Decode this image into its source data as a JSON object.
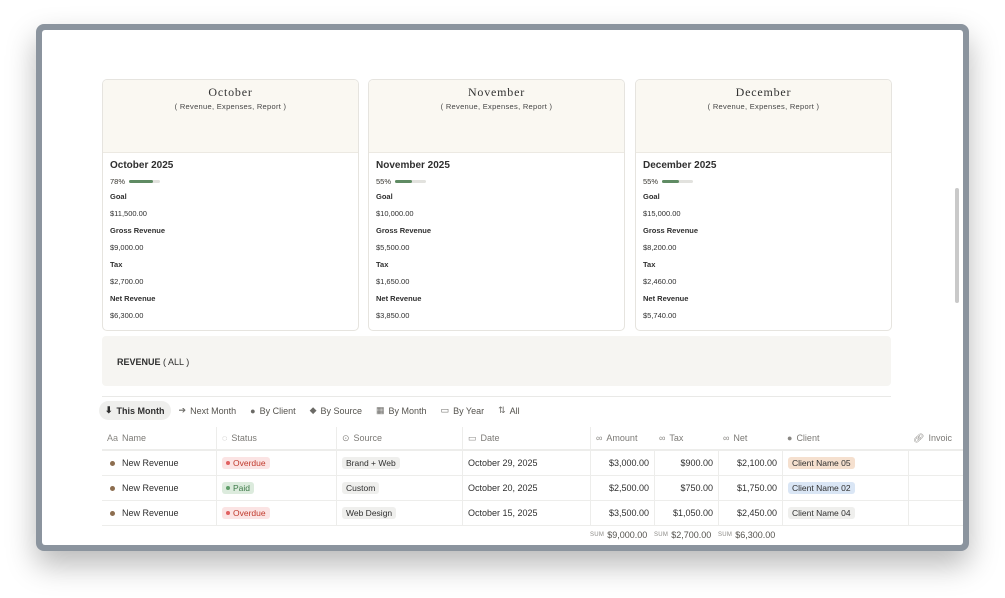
{
  "cards": [
    {
      "cover_title": "October",
      "cover_sub": "( Revenue, Expenses, Report )",
      "title": "October 2025",
      "progress_label": "78%",
      "progress": 0.78,
      "goal_label": "Goal",
      "goal": "$11,500.00",
      "gross_label": "Gross Revenue",
      "gross": "$9,000.00",
      "tax_label": "Tax",
      "tax": "$2,700.00",
      "net_label": "Net Revenue",
      "net": "$6,300.00"
    },
    {
      "cover_title": "November",
      "cover_sub": "( Revenue, Expenses, Report )",
      "title": "November 2025",
      "progress_label": "55%",
      "progress": 0.55,
      "goal_label": "Goal",
      "goal": "$10,000.00",
      "gross_label": "Gross Revenue",
      "gross": "$5,500.00",
      "tax_label": "Tax",
      "tax": "$1,650.00",
      "net_label": "Net Revenue",
      "net": "$3,850.00"
    },
    {
      "cover_title": "December",
      "cover_sub": "( Revenue, Expenses, Report )",
      "title": "December 2025",
      "progress_label": "55%",
      "progress": 0.55,
      "goal_label": "Goal",
      "goal": "$15,000.00",
      "gross_label": "Gross Revenue",
      "gross": "$8,200.00",
      "tax_label": "Tax",
      "tax": "$2,460.00",
      "net_label": "Net Revenue",
      "net": "$5,740.00"
    }
  ],
  "revenue_section": {
    "title": "REVENUE",
    "suffix": " ( ALL )"
  },
  "tabs": [
    {
      "label": "This Month",
      "icon": "⬇"
    },
    {
      "label": "Next Month",
      "icon": "➔"
    },
    {
      "label": "By Client",
      "icon": "●"
    },
    {
      "label": "By Source",
      "icon": "◆"
    },
    {
      "label": "By Month",
      "icon": "▦"
    },
    {
      "label": "By Year",
      "icon": "▭"
    },
    {
      "label": "All",
      "icon": "⇅"
    }
  ],
  "columns": {
    "name": "Name",
    "status": "Status",
    "source": "Source",
    "date": "Date",
    "amount": "Amount",
    "tax": "Tax",
    "net": "Net",
    "client": "Client",
    "invoice": "Invoic"
  },
  "rows": [
    {
      "name": "New Revenue",
      "status": "Overdue",
      "source": "Brand + Web",
      "date": "October 29, 2025",
      "amount": "$3,000.00",
      "tax": "$900.00",
      "net": "$2,100.00",
      "client": "Client Name 05"
    },
    {
      "name": "New Revenue",
      "status": "Paid",
      "source": "Custom",
      "date": "October 20, 2025",
      "amount": "$2,500.00",
      "tax": "$750.00",
      "net": "$1,750.00",
      "client": "Client Name 02"
    },
    {
      "name": "New Revenue",
      "status": "Overdue",
      "source": "Web Design",
      "date": "October 15, 2025",
      "amount": "$3,500.00",
      "tax": "$1,050.00",
      "net": "$2,450.00",
      "client": "Client Name 04"
    }
  ],
  "sums": {
    "label": "SUM",
    "amount": "$9,000.00",
    "tax": "$2,700.00",
    "net": "$6,300.00"
  },
  "colors": {
    "overdue_bg": "#fbe4e4",
    "overdue_dot": "#e16161",
    "overdue_text": "#c0392b",
    "paid_bg": "#dcebdd",
    "paid_dot": "#5f9e6a",
    "paid_text": "#3f7a4a",
    "client05_bg": "#f5e0cf",
    "client02_bg": "#dae6f5",
    "client04_bg": "#efefed",
    "progress_fill": "#5f8b63"
  }
}
